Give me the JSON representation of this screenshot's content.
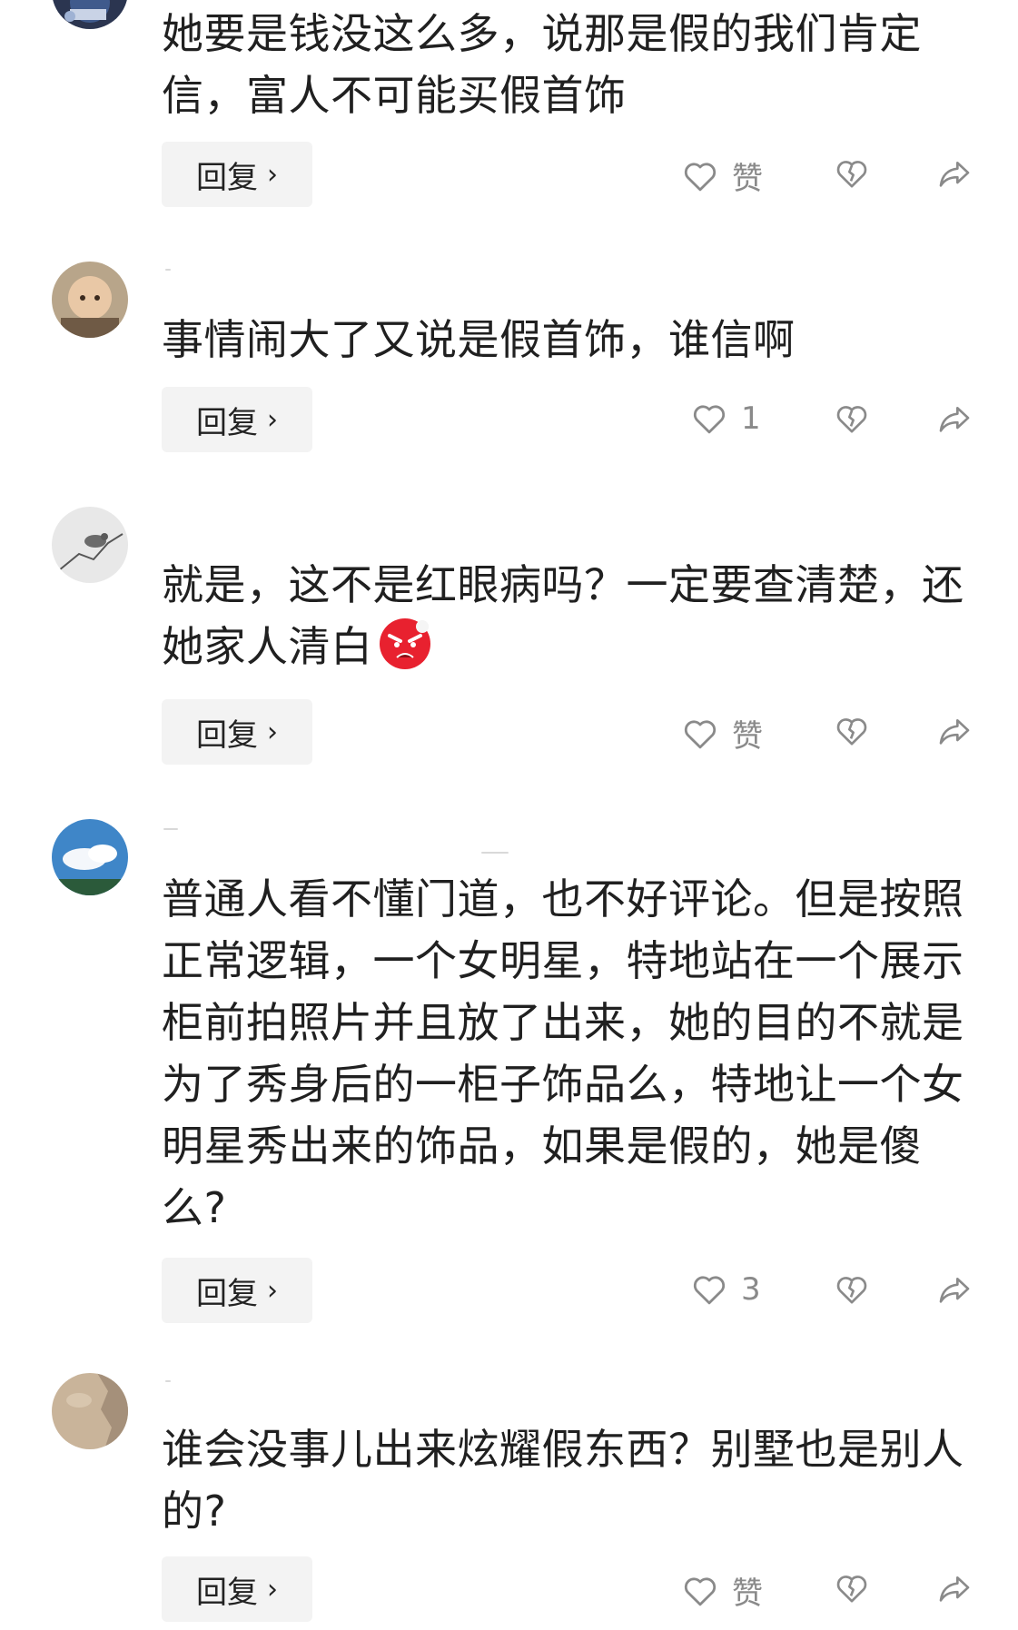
{
  "comments": [
    {
      "text": "她要是钱没这么多，说那是假的我们肯定信，富人不可能买假首饰",
      "reply_label": "回复",
      "like_text": "赞",
      "avatar": "avatar-dark-cartoon"
    },
    {
      "text": "事情闹大了又说是假首饰，谁信啊",
      "reply_label": "回复",
      "like_text": "1",
      "avatar": "avatar-baby-photo"
    },
    {
      "text": "就是，这不是红眼病吗？一定要查清楚，还她家人清白",
      "reply_label": "回复",
      "like_text": "赞",
      "avatar": "avatar-bird-sketch",
      "emoji": "angry-face-emoji"
    },
    {
      "text": "普通人看不懂门道，也不好评论。但是按照正常逻辑，一个女明星，特地站在一个展示柜前拍照片并且放了出来，她的目的不就是为了秀身后的一柜子饰品么，特地让一个女明星秀出来的饰品，如果是假的，她是傻么?",
      "reply_label": "回复",
      "like_text": "3",
      "avatar": "avatar-sky-clouds"
    },
    {
      "text": "谁会没事儿出来炫耀假东西？别墅也是别人的?",
      "reply_label": "回复",
      "like_text": "赞",
      "avatar": "avatar-sand-photo"
    }
  ],
  "colors": {
    "text": "#202020",
    "reply_bg": "#f3f3f3",
    "icon": "#8a8a8a",
    "emoji_red": "#e8212f"
  }
}
